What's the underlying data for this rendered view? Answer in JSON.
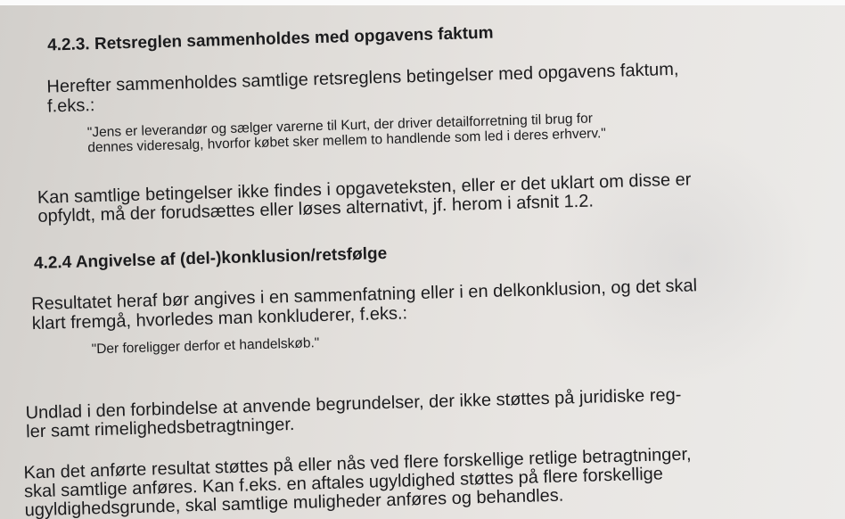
{
  "section_423": {
    "heading": "4.2.3. Retsreglen sammenholdes med opgavens faktum",
    "para1": [
      "Herefter sammenholdes samtlige retsreglens betingelser med opgavens faktum,",
      "f.eks.:"
    ],
    "quote": [
      "\"Jens er leverandør og sælger varerne til Kurt, der driver detailforretning til brug for",
      "dennes videresalg, hvorfor købet sker mellem to handlende som led i deres erhverv.\""
    ],
    "para2": [
      "Kan samtlige betingelser ikke findes i opgaveteksten, eller er det uklart om disse er",
      "opfyldt, må der forudsættes eller løses alternativt, jf. herom i afsnit 1.2."
    ]
  },
  "section_424": {
    "heading": "4.2.4 Angivelse af (del-)konklusion/retsfølge",
    "para1": [
      "Resultatet heraf bør angives i en sammenfatning eller i en delkonklusion, og det skal",
      "klart fremgå, hvorledes man konkluderer, f.eks.:"
    ],
    "quote": "\"Der foreligger derfor et handelskøb.\"",
    "para2": [
      "Undlad i den forbindelse at anvende begrundelser, der ikke støttes på juridiske reg-",
      "ler samt rimelighedsbetragtninger."
    ],
    "para3": [
      "Kan det anførte resultat støttes på eller nås ved flere forskellige retlige betragtninger,",
      "skal samtlige anføres. Kan f.eks. en aftales ugyldighed støttes på flere forskellige",
      "ugyldighedsgrunde, skal samtlige muligheder anføres og behandles."
    ]
  }
}
